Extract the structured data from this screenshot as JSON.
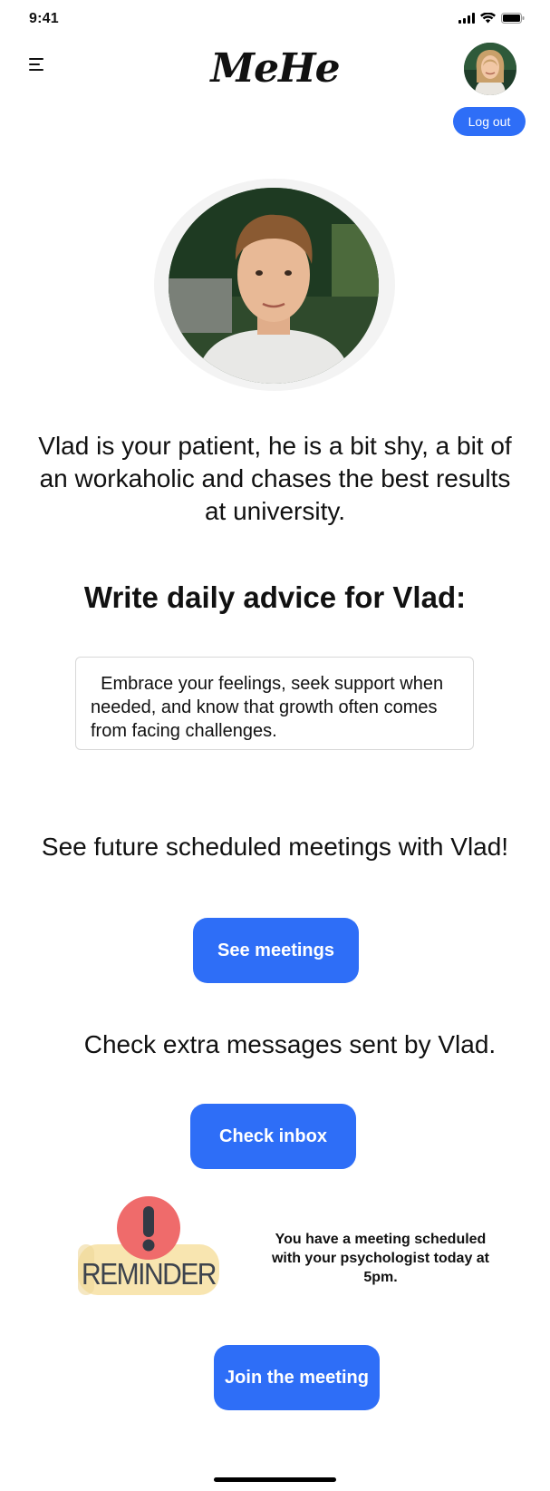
{
  "status_bar": {
    "time": "9:41"
  },
  "header": {
    "brand": "MeHe",
    "logout_label": "Log out"
  },
  "patient": {
    "description": "Vlad is your patient, he is a bit shy, a bit of an workaholic and chases the best results at university."
  },
  "advice": {
    "title": "Write daily advice for Vlad:",
    "value": "  Embrace your feelings, seek support when needed, and know that growth often comes from facing challenges."
  },
  "meetings": {
    "text": "See future scheduled meetings with Vlad!",
    "button_label": "See meetings"
  },
  "inbox": {
    "text": "Check extra messages sent by Vlad.",
    "button_label": "Check inbox"
  },
  "reminder": {
    "badge_text": "REMINDER",
    "message": "You have a meeting scheduled with your psychologist today at 5pm.",
    "button_label": "Join the meeting"
  },
  "colors": {
    "accent": "#2e6ef7",
    "reminder_red": "#ef6b6b",
    "reminder_yellow": "#f8e5b0"
  },
  "icons": [
    "menu-icon",
    "signal-icon",
    "wifi-icon",
    "battery-icon",
    "alert-icon"
  ]
}
